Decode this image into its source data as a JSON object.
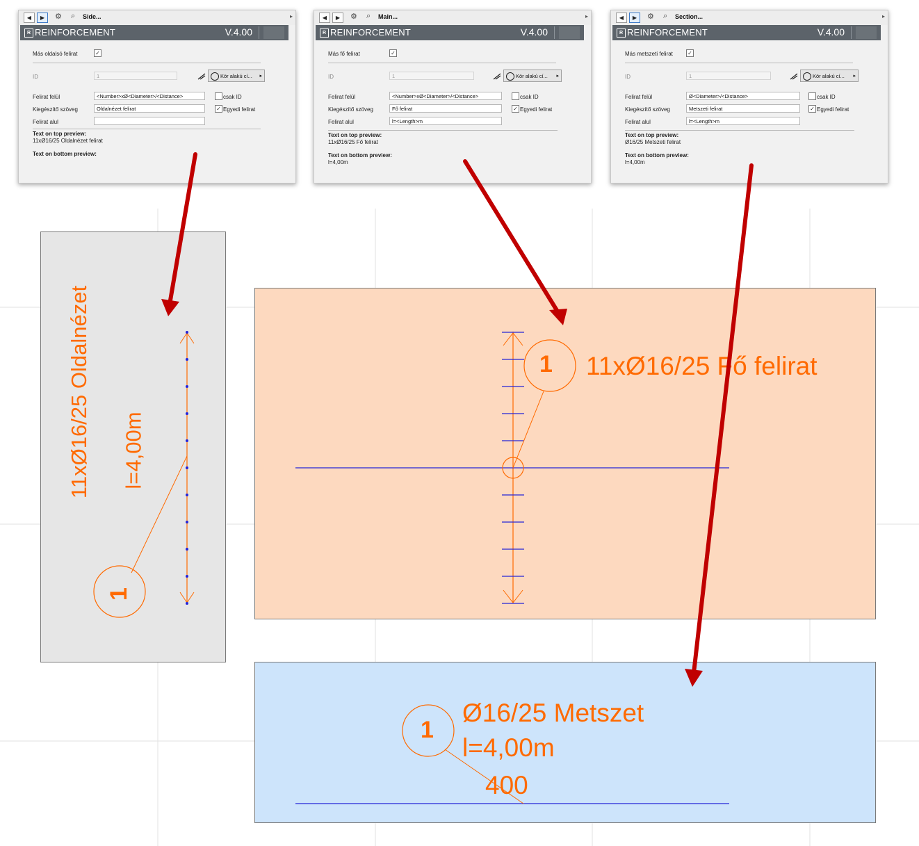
{
  "panels": [
    {
      "toolbar_title": "Side...",
      "app_name": "REINFORCEMENT",
      "version": "V.4.00",
      "other_label_text": "Más oldalsó felirat",
      "other_checked": "✓",
      "id_label": "ID",
      "id_value": "1",
      "shape_button": "Kör alakú cí...",
      "top_label": "Felirat felül",
      "top_value": "<Number>xØ<Diameter>/<Distance>",
      "suffix_label": "Kiegészítő szöveg",
      "suffix_value": "Oldalnézet felirat",
      "bottom_label": "Felirat alul",
      "bottom_value": "",
      "only_id_label": "csak ID",
      "only_id_checked": "",
      "custom_label": "Egyedi felirat",
      "custom_checked": "✓",
      "top_preview_title": "Text on top preview:",
      "top_preview_value": "11xØ16/25 Oldalnézet felirat",
      "bottom_preview_title": "Text on bottom preview:",
      "bottom_preview_value": ""
    },
    {
      "toolbar_title": "Main...",
      "app_name": "REINFORCEMENT",
      "version": "V.4.00",
      "other_label_text": "Más fő felirat",
      "other_checked": "✓",
      "id_label": "ID",
      "id_value": "1",
      "shape_button": "Kör alakú cí...",
      "top_label": "Felirat felül",
      "top_value": "<Number>xØ<Diameter>/<Distance>",
      "suffix_label": "Kiegészítő szöveg",
      "suffix_value": "Fő felirat",
      "bottom_label": "Felirat alul",
      "bottom_value": "l=<Length>m",
      "only_id_label": "csak ID",
      "only_id_checked": "",
      "custom_label": "Egyedi felirat",
      "custom_checked": "✓",
      "top_preview_title": "Text on top preview:",
      "top_preview_value": "11xØ16/25 Fő felirat",
      "bottom_preview_title": "Text on bottom preview:",
      "bottom_preview_value": "l=4,00m"
    },
    {
      "toolbar_title": "Section...",
      "app_name": "REINFORCEMENT",
      "version": "V.4.00",
      "other_label_text": "Más metszeti felirat",
      "other_checked": "✓",
      "id_label": "ID",
      "id_value": "1",
      "shape_button": "Kör alakú cí...",
      "top_label": "Felirat felül",
      "top_value": "Ø<Diameter>/<Distance>",
      "suffix_label": "Kiegészítő szöveg",
      "suffix_value": "Metszeti felirat",
      "bottom_label": "Felirat alul",
      "bottom_value": "l=<Length>m",
      "only_id_label": "csak ID",
      "only_id_checked": "",
      "custom_label": "Egyedi felirat",
      "custom_checked": "✓",
      "top_preview_title": "Text on top preview:",
      "top_preview_value": "Ø16/25 Metszeti felirat",
      "bottom_preview_title": "Text on bottom preview:",
      "bottom_preview_value": "l=4,00m"
    }
  ],
  "views": {
    "side": {
      "marker": "1",
      "line1": "11xØ16/25 Oldalnézet",
      "line2": "l=4,00m",
      "background": "#e6e6e6"
    },
    "main": {
      "marker": "1",
      "line1": "11xØ16/25 Fő felirat",
      "background": "#fdd9bf"
    },
    "section": {
      "marker": "1",
      "line1": "Ø16/25 Metszet",
      "line2": "l=4,00m",
      "line3": "400",
      "background": "#cde4fb"
    }
  },
  "colors": {
    "annotation": "#ff6a00",
    "rebar_blue": "#2424d8",
    "arrow_red": "#c00000"
  }
}
